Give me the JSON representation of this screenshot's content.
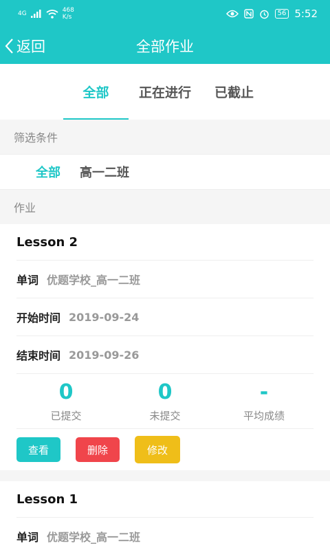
{
  "status_bar": {
    "signal": "4G",
    "speed_value": "468",
    "speed_unit": "K/s",
    "battery": "56",
    "time": "5:52"
  },
  "nav": {
    "back_label": "返回",
    "title": "全部作业"
  },
  "tabs": [
    {
      "label": "全部",
      "active": true
    },
    {
      "label": "正在进行",
      "active": false
    },
    {
      "label": "已截止",
      "active": false
    }
  ],
  "filter": {
    "section_label": "筛选条件",
    "items": [
      {
        "label": "全部",
        "active": true
      },
      {
        "label": "高一二班",
        "active": false
      }
    ]
  },
  "homework": {
    "section_label": "作业",
    "cards": [
      {
        "title": "Lesson 2",
        "type_label": "单词",
        "type_value": "优题学校_高一二班",
        "start_label": "开始时间",
        "start_value": "2019-09-24",
        "end_label": "结束时间",
        "end_value": "2019-09-26",
        "submitted_value": "0",
        "submitted_label": "已提交",
        "unsubmitted_value": "0",
        "unsubmitted_label": "未提交",
        "average_value": "-",
        "average_label": "平均成绩",
        "btn_view": "查看",
        "btn_delete": "删除",
        "btn_edit": "修改"
      },
      {
        "title": "Lesson 1",
        "type_label": "单词",
        "type_value": "优题学校_高一二班"
      }
    ]
  },
  "colors": {
    "accent": "#1fc7c7",
    "danger": "#f0454b",
    "warning": "#efbe19"
  }
}
